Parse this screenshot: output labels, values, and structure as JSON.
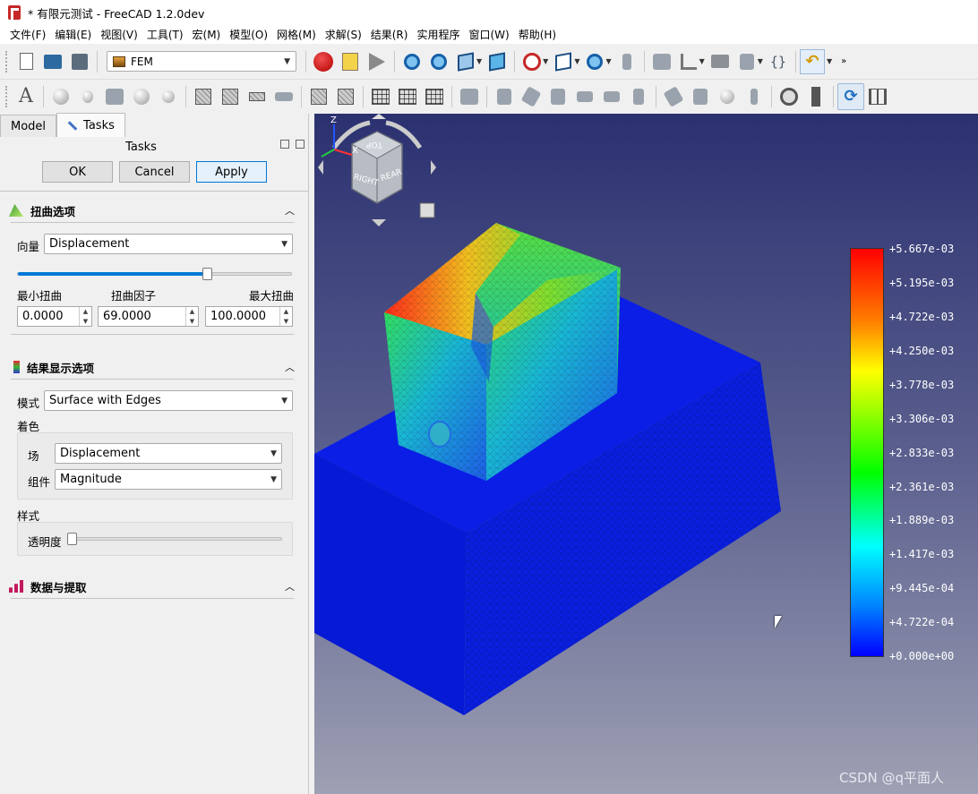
{
  "window": {
    "title": "* 有限元测试 - FreeCAD 1.2.0dev"
  },
  "menu": [
    "文件(F)",
    "编辑(E)",
    "视图(V)",
    "工具(T)",
    "宏(M)",
    "模型(O)",
    "网格(M)",
    "求解(S)",
    "结果(R)",
    "实用程序",
    "窗口(W)",
    "帮助(H)"
  ],
  "toolbar": {
    "workbench": "FEM"
  },
  "panel": {
    "tabs": [
      "Model",
      "Tasks"
    ],
    "active_tab": "Tasks",
    "tasks_title": "Tasks",
    "buttons": {
      "ok": "OK",
      "cancel": "Cancel",
      "apply": "Apply"
    },
    "warp": {
      "title": "扭曲选项",
      "vector_label": "向量",
      "vector_value": "Displacement",
      "slider_fraction": 0.69,
      "min_label": "最小扭曲",
      "factor_label": "扭曲因子",
      "max_label": "最大扭曲",
      "min_value": "0.0000",
      "factor_value": "69.0000",
      "max_value": "100.0000"
    },
    "display": {
      "title": "结果显示选项",
      "mode_label": "模式",
      "mode_value": "Surface with Edges",
      "coloring_label": "着色",
      "field_label": "场",
      "field_value": "Displacement",
      "component_label": "组件",
      "component_value": "Magnitude",
      "style_label": "样式",
      "transparency_label": "透明度",
      "transparency_fraction": 0.0
    },
    "data": {
      "title": "数据与提取"
    }
  },
  "viewport": {
    "navcube_faces": [
      "TOP",
      "RIGHT",
      "REAR"
    ],
    "legend": [
      "+5.667e-03",
      "+5.195e-03",
      "+4.722e-03",
      "+4.250e-03",
      "+3.778e-03",
      "+3.306e-03",
      "+2.833e-03",
      "+2.361e-03",
      "+1.889e-03",
      "+1.417e-03",
      "+9.445e-04",
      "+4.722e-04",
      "+0.000e+00"
    ],
    "axis_labels": {
      "z": "Z",
      "x": "X"
    },
    "watermark": "CSDN @q平面人"
  }
}
